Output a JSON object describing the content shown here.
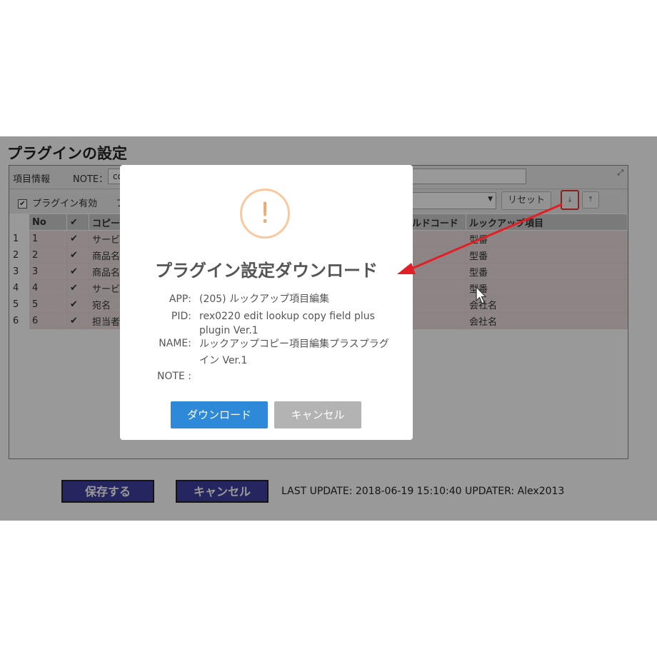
{
  "page": {
    "title": "プラグインの設定"
  },
  "toolbar": {
    "item_info_label": "項目情報",
    "note_label": "NOTE：",
    "note_value": "co",
    "plugin_enabled_label": "プラグイン有効",
    "plugin_enabled_checked": "✔",
    "row2_hint": "フ",
    "reset_label": "リセット",
    "download_icon_glyph": "⤓",
    "upload_icon_glyph": "⤒",
    "expand_icon_glyph": "⤢"
  },
  "table": {
    "headers": {
      "no": "No",
      "check": "✔",
      "copy": "コピー",
      "field_code": "フィールドコード",
      "lookup": "ルックアップ項目"
    },
    "rows": [
      {
        "rownum": "1",
        "no": "1",
        "check": "✔",
        "name": "サービス",
        "lookup": "型番"
      },
      {
        "rownum": "2",
        "no": "2",
        "check": "✔",
        "name": "商品名",
        "lookup": "型番"
      },
      {
        "rownum": "3",
        "no": "3",
        "check": "✔",
        "name": "商品名",
        "lookup": "型番"
      },
      {
        "rownum": "4",
        "no": "4",
        "check": "✔",
        "name": "サービス",
        "lookup": "型番"
      },
      {
        "rownum": "5",
        "no": "5",
        "check": "✔",
        "name": "宛名",
        "lookup": "会社名"
      },
      {
        "rownum": "6",
        "no": "6",
        "check": "✔",
        "name": "担当者",
        "lookup": "会社名"
      }
    ]
  },
  "footer": {
    "save_label": "保存する",
    "cancel_label": "キャンセル",
    "last_update": "LAST UPDATE: 2018-06-19 15:10:40 UPDATER: Alex2013"
  },
  "modal": {
    "icon_glyph": "!",
    "title": "プラグイン設定ダウンロード",
    "app_label": "APP:",
    "app_value": "(205) ルックアップ項目編集",
    "pid_label": "PID:",
    "pid_value": "rex0220 edit lookup copy field plus plugin Ver.1",
    "name_label": "NAME:",
    "name_value": "ルックアップコピー項目編集プラスプラグイン Ver.1",
    "note_label": "NOTE :",
    "note_value": "",
    "download_label": "ダウンロード",
    "cancel_label": "キャンセル"
  },
  "colors": {
    "primary_button": "#2e8ad8",
    "secondary_button": "#b3b3b3",
    "warning_ring": "#f8c9a0",
    "warning_glyph": "#f3a96a",
    "annotation_red": "#e31e24",
    "legacy_button": "#3f3fa0"
  }
}
